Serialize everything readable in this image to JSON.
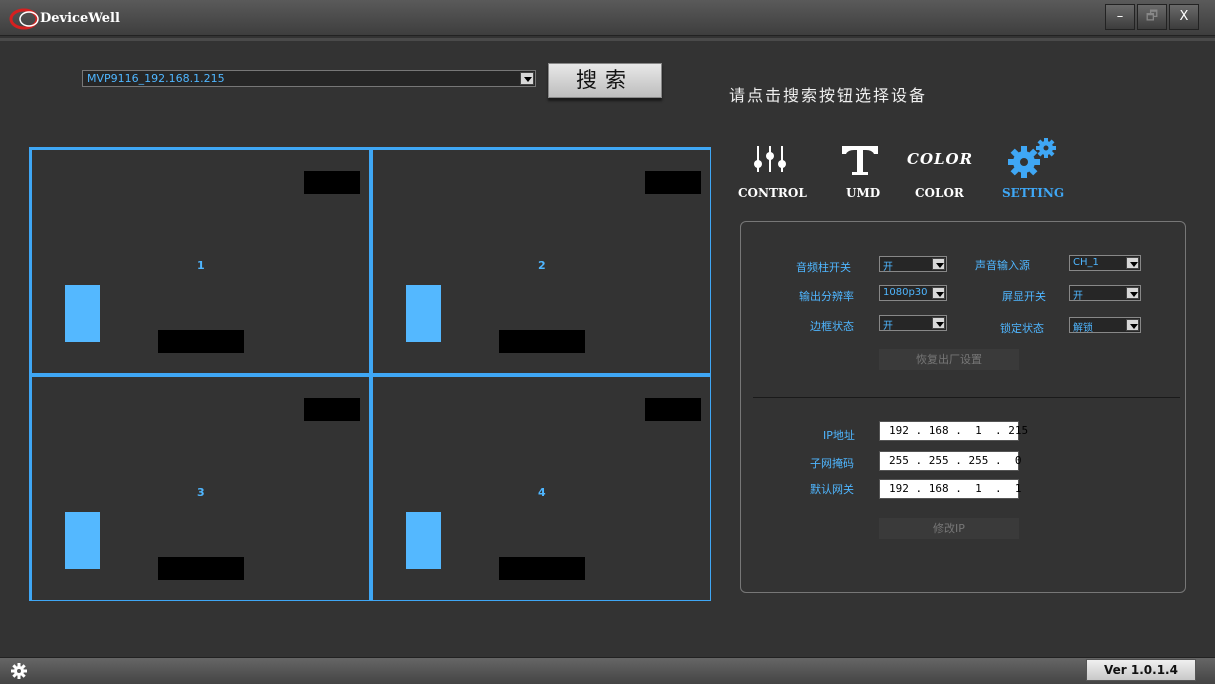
{
  "app": {
    "title": "DeviceWell"
  },
  "window": {
    "minimize": "–",
    "restore": "🗗",
    "close": "X"
  },
  "device": {
    "selected": "MVP9116_192.168.1.215",
    "search_label": "搜索",
    "hint": "请点击搜索按钮选择设备"
  },
  "preview": {
    "cells": [
      "1",
      "2",
      "3",
      "4"
    ]
  },
  "tabs": [
    {
      "label": "CONTROL",
      "icon": "sliders-icon"
    },
    {
      "label": "UMD",
      "icon": "text-t-icon"
    },
    {
      "label": "COLOR",
      "icon_text": "COLOR",
      "icon": "color-text-icon"
    },
    {
      "label": "SETTING",
      "icon": "gears-icon",
      "active": true
    }
  ],
  "settings": {
    "audio_bar_label": "音频柱开关",
    "audio_bar_value": "开",
    "audio_source_label": "声音输入源",
    "audio_source_value": "CH_1",
    "output_res_label": "输出分辨率",
    "output_res_value": "1080p30",
    "osd_label": "屏显开关",
    "osd_value": "开",
    "border_label": "边框状态",
    "border_value": "开",
    "lock_label": "锁定状态",
    "lock_value": "解锁",
    "factory_reset": "恢复出厂设置"
  },
  "network": {
    "ip_label": "IP地址",
    "ip_value": "192 . 168 .  1  . 215",
    "mask_label": "子网掩码",
    "mask_value": "255 . 255 . 255 .  0",
    "gateway_label": "默认网关",
    "gateway_value": "192 . 168 .  1  .  1",
    "modify_ip": "修改IP"
  },
  "status": {
    "version": "Ver 1.0.1.4"
  },
  "colors": {
    "accent": "#3fa7f5",
    "meter": "#54b8ff",
    "background": "#333333"
  }
}
